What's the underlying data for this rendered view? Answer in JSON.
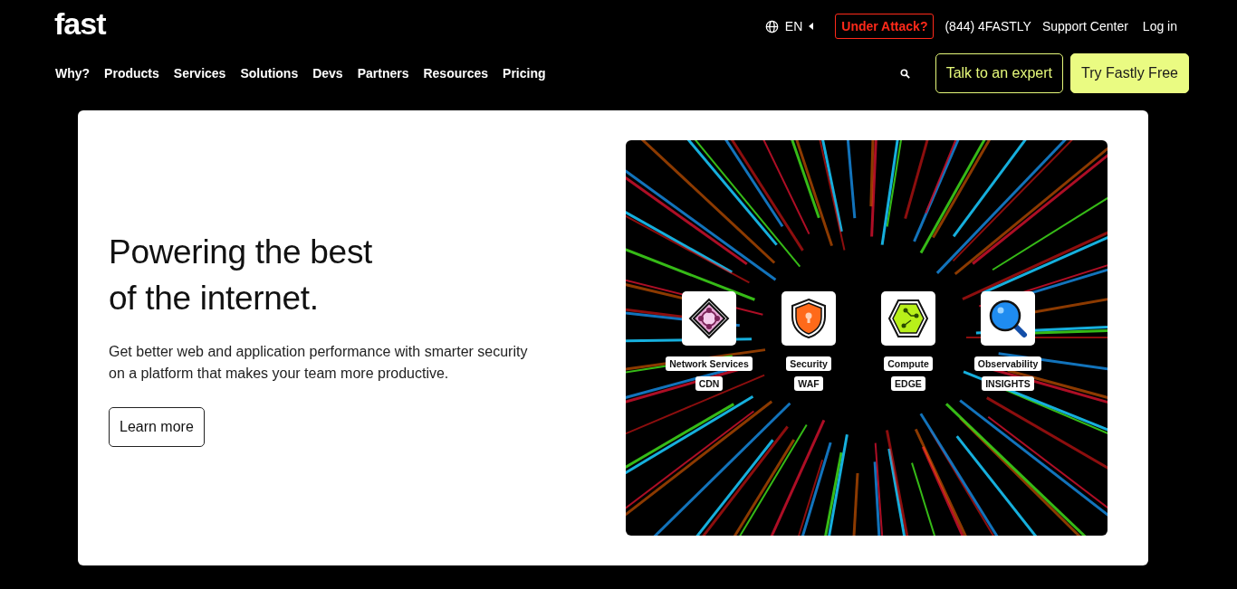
{
  "logo": {
    "text": "fast"
  },
  "utility": {
    "language": "EN",
    "under_attack": "Under Attack?",
    "phone": "(844) 4FASTLY",
    "links": [
      "Support Center",
      "Log in"
    ]
  },
  "nav": [
    "Why?",
    "Products",
    "Services",
    "Solutions",
    "Devs",
    "Partners",
    "Resources",
    "Pricing"
  ],
  "actions": [
    {
      "label": "Talk to an expert",
      "kind": "outline"
    },
    {
      "label": "Try Fastly Free",
      "kind": "filled"
    }
  ],
  "hero": {
    "heading_lines": [
      "Powering the best",
      "of the internet."
    ],
    "body": "Get better web and application performance with smarter security on a platform that makes your team more productive.",
    "button": "Learn more",
    "tiles": [
      {
        "kind": "network",
        "name": "Network Services",
        "tag": "CDN"
      },
      {
        "kind": "security",
        "name": "Security",
        "tag": "WAF"
      },
      {
        "kind": "compute",
        "name": "Compute",
        "tag": "EDGE"
      },
      {
        "kind": "observability",
        "name": "Observability",
        "tag": "INSIGHTS"
      }
    ]
  }
}
